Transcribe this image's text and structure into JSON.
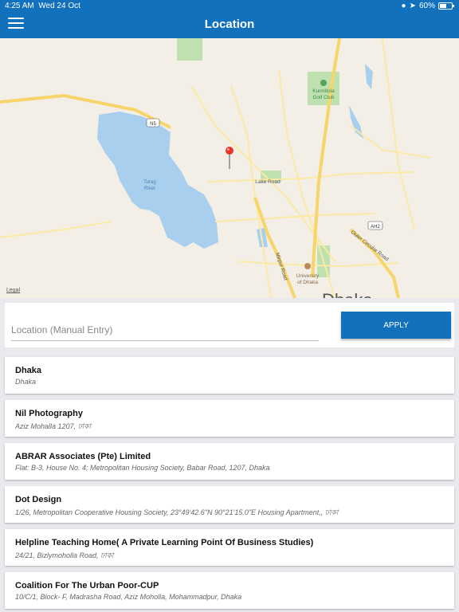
{
  "status_bar": {
    "time": "4:25 AM",
    "date": "Wed 24 Oct",
    "battery": "60%",
    "battery_level": 0.6
  },
  "header": {
    "title": "Location",
    "menu_icon": "hamburger-menu-icon"
  },
  "map": {
    "labels": {
      "kurmitola_line1": "Kurmitola",
      "kurmitola_line2": "Golf Club",
      "n5": "N5",
      "turag_line1": "Turag",
      "turag_line2": "River",
      "lake_road": "Lake Road",
      "mirpur_road": "Mirpur Road",
      "ah2": "AH2",
      "outer_circular": "Outer Circular Road",
      "university_line1": "University",
      "university_line2": "of Dhaka",
      "dhaka": "Dhaka"
    },
    "legal": "Legal",
    "pin_icon": "map-pin-icon",
    "colors": {
      "water": "#a8cfee",
      "park": "#bfe1b0",
      "major_road": "#f6d56a",
      "road": "#fbe9a6"
    }
  },
  "entry": {
    "placeholder": "Location (Manual Entry)",
    "value": "",
    "apply_label": "APPLY"
  },
  "locations": [
    {
      "name": "Dhaka",
      "address": "Dhaka"
    },
    {
      "name": "Nil Photography",
      "address": "Aziz Mohalla 1207, ঢাকা"
    },
    {
      "name": "ABRAR Associates (Pte) Limited",
      "address": "Flat: B-3, House No. 4; Metropolitan Housing Society, Babar Road, 1207, Dhaka"
    },
    {
      "name": "Dot Design",
      "address": "1/26, Metropolitan Cooperative Housing Society, 23°49'42.6\"N 90°21'15.0\"E Housing Apartment,, ঢাকা"
    },
    {
      "name": "Helpline Teaching Home( A Private Learning Point Of Business Studies)",
      "address": "24/21, Bizlymoholla Road, ঢাকা"
    },
    {
      "name": "Coalition For The Urban Poor-CUP",
      "address": "10/C/1, Block- F, Madrasha Road, Aziz Moholla, Mohammadpur, Dhaka"
    }
  ]
}
